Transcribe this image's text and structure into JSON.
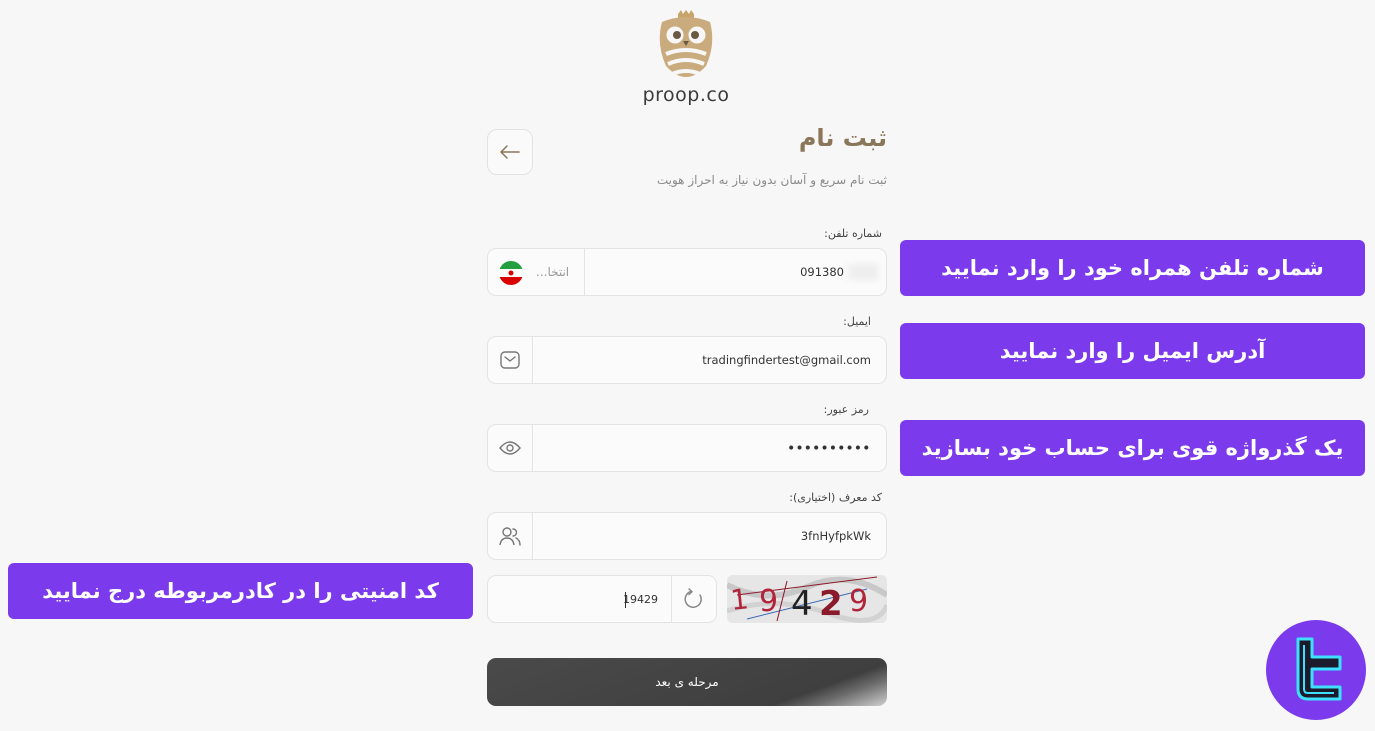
{
  "brand": {
    "name": "proop.co"
  },
  "header": {
    "title": "ثبت نام",
    "subtitle": "ثبت نام سریع و آسان بدون نیاز به احراز هویت"
  },
  "form": {
    "phone": {
      "label": "شماره تلفن:",
      "value": "091380",
      "country_placeholder": "انتخا..."
    },
    "email": {
      "label": "ایمیل:",
      "value": "tradingfindertest@gmail.com"
    },
    "password": {
      "label": "رمز عبور:",
      "value": "••••••••••"
    },
    "referral": {
      "label": "کد معرف (اختیاری):",
      "value": "3fnHyfpkWk"
    },
    "captcha": {
      "value": "19429",
      "image_text": "19429"
    },
    "next_label": "مرحله ی بعد"
  },
  "callouts": {
    "phone": "شماره تلفن همراه خود را وارد نمایید",
    "email": "آدرس ایمیل را وارد نمایید",
    "password": "یک گذرواژه قوی برای حساب خود بسازید",
    "captcha": "کد امنیتی را در کادرمربوطه درج نمایید"
  },
  "icons": [
    "owl-logo-icon",
    "arrow-left-icon",
    "iran-flag-icon",
    "mail-icon",
    "eye-icon",
    "users-icon",
    "refresh-icon",
    "tf-logo-icon"
  ],
  "colors": {
    "accent": "#7c3aed",
    "title": "#8a7658",
    "button": "#444444"
  }
}
